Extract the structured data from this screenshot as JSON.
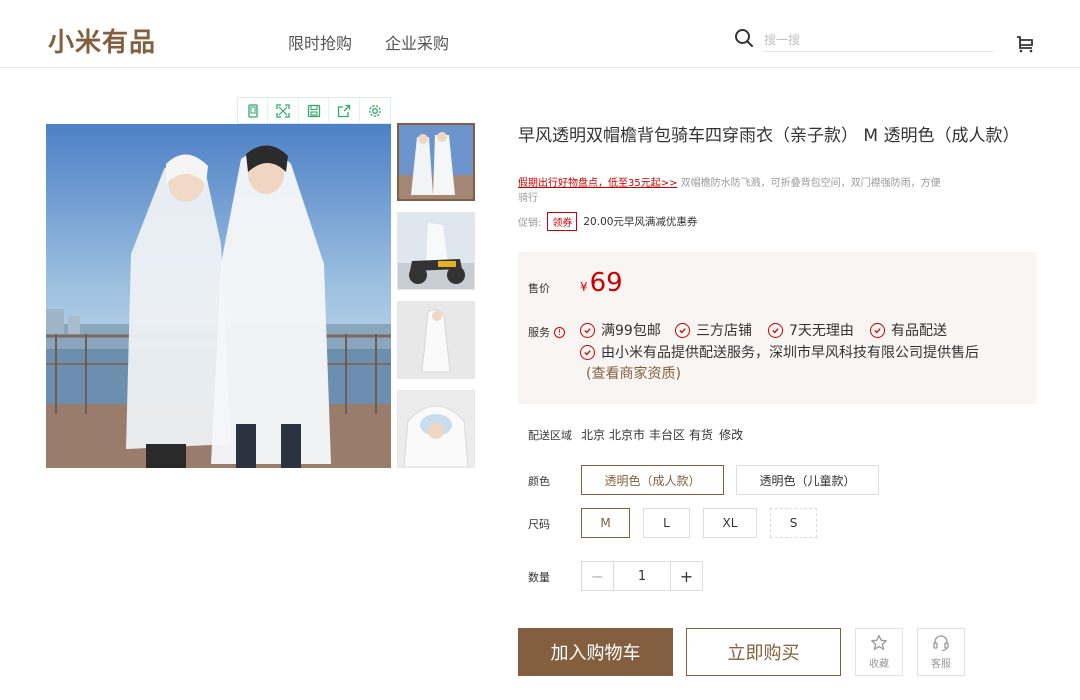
{
  "header": {
    "logo": "小米有品",
    "nav": [
      "限时抢购",
      "企业采购"
    ],
    "search_placeholder": "搜一搜"
  },
  "gallery": {
    "toolbar_icons": [
      "phone-icon",
      "expand-icon",
      "save-icon",
      "share-icon",
      "settings-icon"
    ]
  },
  "product": {
    "title": "早风透明双帽檐背包骑车四穿雨衣（亲子款） M 透明色（成人款）",
    "promo_link": "假期出行好物盘点，低至35元起>>",
    "description": " 双帽檐防水防飞溅，可折叠背包空间，双门襟强防雨，方便骑行",
    "promo_label": "促销:",
    "coupon_tag": "领券",
    "coupon_text": "20.00元早风满减优惠券"
  },
  "price_panel": {
    "price_label": "售价",
    "currency": "¥",
    "price": "69",
    "service_label": "服务",
    "services": [
      "满99包邮",
      "三方店铺",
      "7天无理由",
      "有品配送"
    ],
    "service_note": "由小米有品提供配送服务，深圳市早风科技有限公司提供售后",
    "merchant_link": "(查看商家资质)"
  },
  "delivery": {
    "label": "配送区域",
    "province": "北京",
    "city": "北京市",
    "district": "丰台区",
    "stock": "有货",
    "edit": "修改"
  },
  "color": {
    "label": "颜色",
    "options": [
      "透明色（成人款）",
      "透明色（儿童款）"
    ],
    "selected": 0
  },
  "size": {
    "label": "尺码",
    "options": [
      "M",
      "L",
      "XL",
      "S"
    ],
    "selected": 0
  },
  "quantity": {
    "label": "数量",
    "value": "1",
    "minus": "−",
    "plus": "+"
  },
  "actions": {
    "add_to_cart": "加入购物车",
    "buy_now": "立即购买",
    "favorite": "收藏",
    "service": "客服"
  },
  "colors": {
    "brand": "#845f3f",
    "price_red": "#c00000",
    "panel_bg": "#f9f5f3"
  }
}
